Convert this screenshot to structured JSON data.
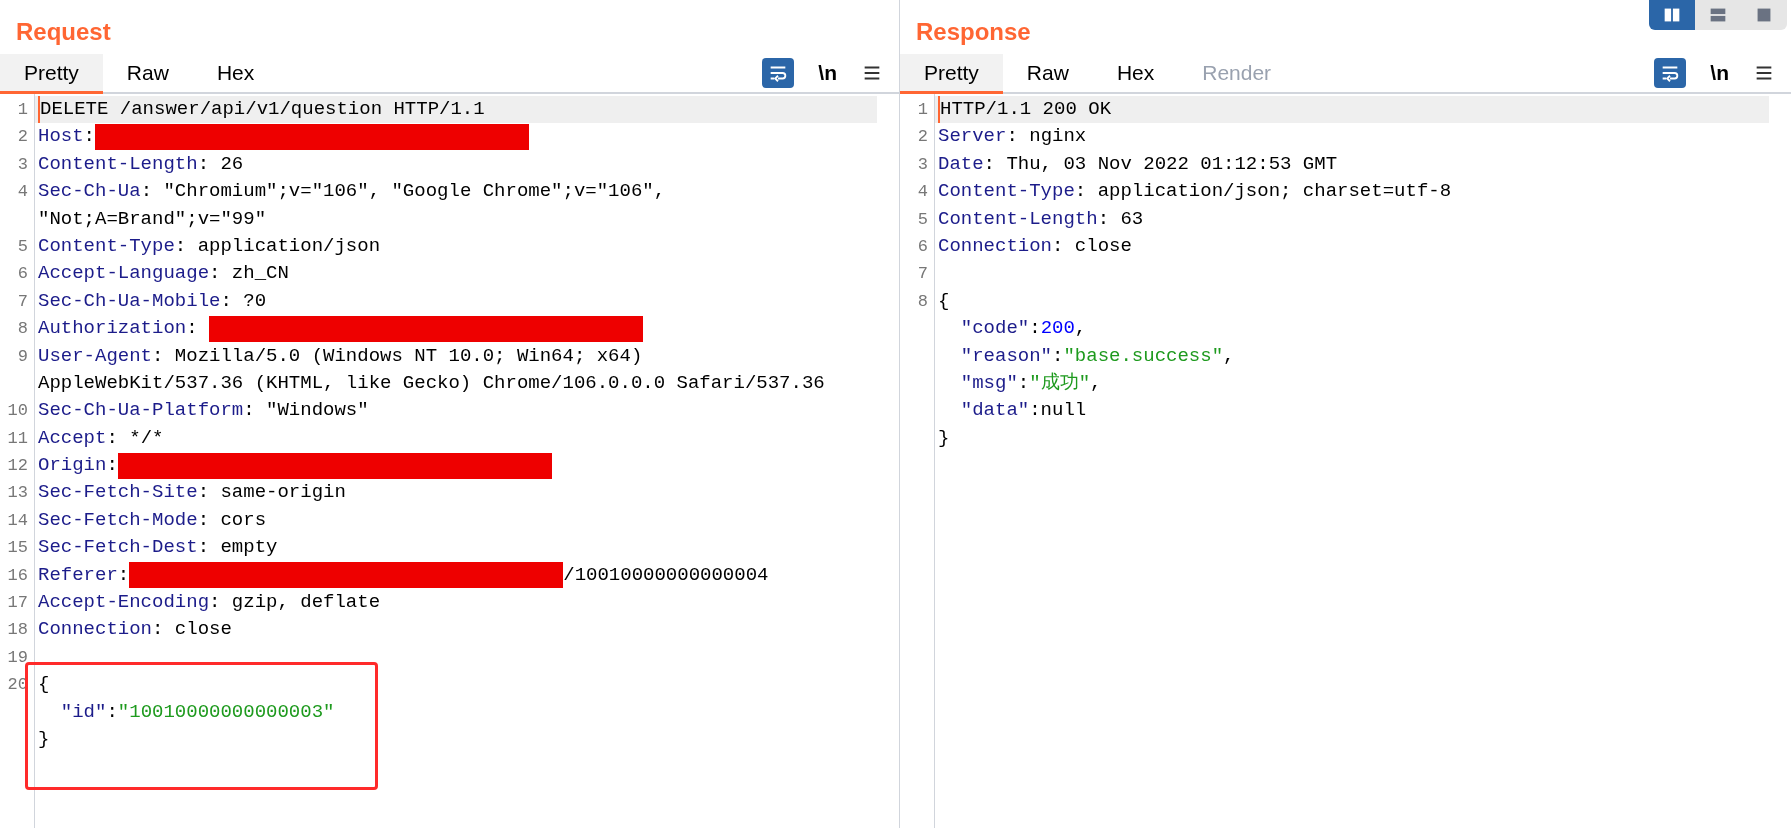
{
  "layout_buttons": [
    {
      "selected": true
    },
    {
      "selected": false
    },
    {
      "selected": false
    }
  ],
  "panes": [
    {
      "title": "Request",
      "tabs": [
        {
          "label": "Pretty",
          "selected": true,
          "disabled": false
        },
        {
          "label": "Raw",
          "selected": false,
          "disabled": false
        },
        {
          "label": "Hex",
          "selected": false,
          "disabled": false
        }
      ],
      "wrap_on": true,
      "newline_label": "\\n",
      "lines": [
        {
          "number": "1",
          "current": true,
          "parts": [
            {
              "tokens": [
                {
                  "kind": "plain",
                  "text": "DELETE /answer/api/v1/question HTTP/1.1"
                }
              ]
            }
          ]
        },
        {
          "number": "2",
          "current": false,
          "parts": [
            {
              "tokens": [
                {
                  "kind": "key",
                  "text": "Host"
                },
                {
                  "kind": "plain",
                  "text": ":"
                },
                {
                  "kind": "redacted"
                }
              ]
            }
          ]
        },
        {
          "number": "3",
          "current": false,
          "parts": [
            {
              "tokens": [
                {
                  "kind": "key",
                  "text": "Content-Length"
                },
                {
                  "kind": "plain",
                  "text": ": 26"
                }
              ]
            }
          ]
        },
        {
          "number": "4",
          "current": false,
          "parts": [
            {
              "tokens": [
                {
                  "kind": "key",
                  "text": "Sec-Ch-Ua"
                },
                {
                  "kind": "plain",
                  "text": ": \"Chromium\";v=\"106\", \"Google Chrome\";v=\"106\","
                }
              ]
            },
            {
              "tokens": [
                {
                  "kind": "plain",
                  "text": "\"Not;A=Brand\";v=\"99\""
                }
              ]
            }
          ]
        },
        {
          "number": "5",
          "current": false,
          "parts": [
            {
              "tokens": [
                {
                  "kind": "key",
                  "text": "Content-Type"
                },
                {
                  "kind": "plain",
                  "text": ": application/json"
                }
              ]
            }
          ]
        },
        {
          "number": "6",
          "current": false,
          "parts": [
            {
              "tokens": [
                {
                  "kind": "key",
                  "text": "Accept-Language"
                },
                {
                  "kind": "plain",
                  "text": ": zh_CN"
                }
              ]
            }
          ]
        },
        {
          "number": "7",
          "current": false,
          "parts": [
            {
              "tokens": [
                {
                  "kind": "key",
                  "text": "Sec-Ch-Ua-Mobile"
                },
                {
                  "kind": "plain",
                  "text": ": ?0"
                }
              ]
            }
          ]
        },
        {
          "number": "8",
          "current": false,
          "parts": [
            {
              "tokens": [
                {
                  "kind": "key",
                  "text": "Authorization"
                },
                {
                  "kind": "plain",
                  "text": ": "
                },
                {
                  "kind": "redacted"
                }
              ]
            }
          ]
        },
        {
          "number": "9",
          "current": false,
          "parts": [
            {
              "tokens": [
                {
                  "kind": "key",
                  "text": "User-Agent"
                },
                {
                  "kind": "plain",
                  "text": ": Mozilla/5.0 (Windows NT 10.0; Win64; x64)"
                }
              ]
            },
            {
              "tokens": [
                {
                  "kind": "plain",
                  "text": "AppleWebKit/537.36 (KHTML, like Gecko) Chrome/106.0.0.0 Safari/537.36"
                }
              ]
            }
          ]
        },
        {
          "number": "10",
          "current": false,
          "parts": [
            {
              "tokens": [
                {
                  "kind": "key",
                  "text": "Sec-Ch-Ua-Platform"
                },
                {
                  "kind": "plain",
                  "text": ": \"Windows\""
                }
              ]
            }
          ]
        },
        {
          "number": "11",
          "current": false,
          "parts": [
            {
              "tokens": [
                {
                  "kind": "key",
                  "text": "Accept"
                },
                {
                  "kind": "plain",
                  "text": ": */*"
                }
              ]
            }
          ]
        },
        {
          "number": "12",
          "current": false,
          "parts": [
            {
              "tokens": [
                {
                  "kind": "key",
                  "text": "Origin"
                },
                {
                  "kind": "plain",
                  "text": ":"
                },
                {
                  "kind": "redacted"
                }
              ]
            }
          ]
        },
        {
          "number": "13",
          "current": false,
          "parts": [
            {
              "tokens": [
                {
                  "kind": "key",
                  "text": "Sec-Fetch-Site"
                },
                {
                  "kind": "plain",
                  "text": ": same-origin"
                }
              ]
            }
          ]
        },
        {
          "number": "14",
          "current": false,
          "parts": [
            {
              "tokens": [
                {
                  "kind": "key",
                  "text": "Sec-Fetch-Mode"
                },
                {
                  "kind": "plain",
                  "text": ": cors"
                }
              ]
            }
          ]
        },
        {
          "number": "15",
          "current": false,
          "parts": [
            {
              "tokens": [
                {
                  "kind": "key",
                  "text": "Sec-Fetch-Dest"
                },
                {
                  "kind": "plain",
                  "text": ": empty"
                }
              ]
            }
          ]
        },
        {
          "number": "16",
          "current": false,
          "parts": [
            {
              "tokens": [
                {
                  "kind": "key",
                  "text": "Referer"
                },
                {
                  "kind": "plain",
                  "text": ":"
                },
                {
                  "kind": "redacted"
                },
                {
                  "kind": "plain",
                  "text": "/10010000000000004"
                }
              ]
            }
          ]
        },
        {
          "number": "17",
          "current": false,
          "parts": [
            {
              "tokens": [
                {
                  "kind": "key",
                  "text": "Accept-Encoding"
                },
                {
                  "kind": "plain",
                  "text": ": gzip, deflate"
                }
              ]
            }
          ]
        },
        {
          "number": "18",
          "current": false,
          "parts": [
            {
              "tokens": [
                {
                  "kind": "key",
                  "text": "Connection"
                },
                {
                  "kind": "plain",
                  "text": ": close"
                }
              ]
            }
          ]
        },
        {
          "number": "19",
          "current": false
        },
        {
          "number": "20",
          "current": false,
          "parts": [
            {
              "tokens": [
                {
                  "kind": "plain",
                  "text": "{"
                }
              ]
            },
            {
              "tokens": [
                {
                  "kind": "key",
                  "text": "  \"id\""
                },
                {
                  "kind": "plain",
                  "text": ":"
                },
                {
                  "kind": "string",
                  "text": "\"10010000000000003\""
                }
              ]
            },
            {
              "tokens": [
                {
                  "kind": "plain",
                  "text": "}"
                }
              ]
            }
          ]
        }
      ]
    },
    {
      "title": "Response",
      "tabs": [
        {
          "label": "Pretty",
          "selected": true,
          "disabled": false
        },
        {
          "label": "Raw",
          "selected": false,
          "disabled": false
        },
        {
          "label": "Hex",
          "selected": false,
          "disabled": false
        },
        {
          "label": "Render",
          "selected": false,
          "disabled": true
        }
      ],
      "wrap_on": true,
      "newline_label": "\\n",
      "lines": [
        {
          "number": "1",
          "current": true,
          "parts": [
            {
              "tokens": [
                {
                  "kind": "plain",
                  "text": "HTTP/1.1 200 OK"
                }
              ]
            }
          ]
        },
        {
          "number": "2",
          "current": false,
          "parts": [
            {
              "tokens": [
                {
                  "kind": "key",
                  "text": "Server"
                },
                {
                  "kind": "plain",
                  "text": ": nginx"
                }
              ]
            }
          ]
        },
        {
          "number": "3",
          "current": false,
          "parts": [
            {
              "tokens": [
                {
                  "kind": "key",
                  "text": "Date"
                },
                {
                  "kind": "plain",
                  "text": ": Thu, 03 Nov 2022 01:12:53 GMT"
                }
              ]
            }
          ]
        },
        {
          "number": "4",
          "current": false,
          "parts": [
            {
              "tokens": [
                {
                  "kind": "key",
                  "text": "Content-Type"
                },
                {
                  "kind": "plain",
                  "text": ": application/json; charset=utf-8"
                }
              ]
            }
          ]
        },
        {
          "number": "5",
          "current": false,
          "parts": [
            {
              "tokens": [
                {
                  "kind": "key",
                  "text": "Content-Length"
                },
                {
                  "kind": "plain",
                  "text": ": 63"
                }
              ]
            }
          ]
        },
        {
          "number": "6",
          "current": false,
          "parts": [
            {
              "tokens": [
                {
                  "kind": "key",
                  "text": "Connection"
                },
                {
                  "kind": "plain",
                  "text": ": close"
                }
              ]
            }
          ]
        },
        {
          "number": "7",
          "current": false
        },
        {
          "number": "8",
          "current": false,
          "parts": [
            {
              "tokens": [
                {
                  "kind": "plain",
                  "text": "{"
                }
              ]
            },
            {
              "tokens": [
                {
                  "kind": "key",
                  "text": "  \"code\""
                },
                {
                  "kind": "plain",
                  "text": ":"
                },
                {
                  "kind": "number",
                  "text": "200"
                },
                {
                  "kind": "plain",
                  "text": ","
                }
              ]
            },
            {
              "tokens": [
                {
                  "kind": "key",
                  "text": "  \"reason\""
                },
                {
                  "kind": "plain",
                  "text": ":"
                },
                {
                  "kind": "string",
                  "text": "\"base.success\""
                },
                {
                  "kind": "plain",
                  "text": ","
                }
              ]
            },
            {
              "tokens": [
                {
                  "kind": "key",
                  "text": "  \"msg\""
                },
                {
                  "kind": "plain",
                  "text": ":"
                },
                {
                  "kind": "string",
                  "text": "\"成功\""
                },
                {
                  "kind": "plain",
                  "text": ","
                }
              ]
            },
            {
              "tokens": [
                {
                  "kind": "key",
                  "text": "  \"data\""
                },
                {
                  "kind": "plain",
                  "text": ":null"
                }
              ]
            },
            {
              "tokens": [
                {
                  "kind": "plain",
                  "text": "}"
                }
              ]
            }
          ]
        }
      ]
    }
  ]
}
